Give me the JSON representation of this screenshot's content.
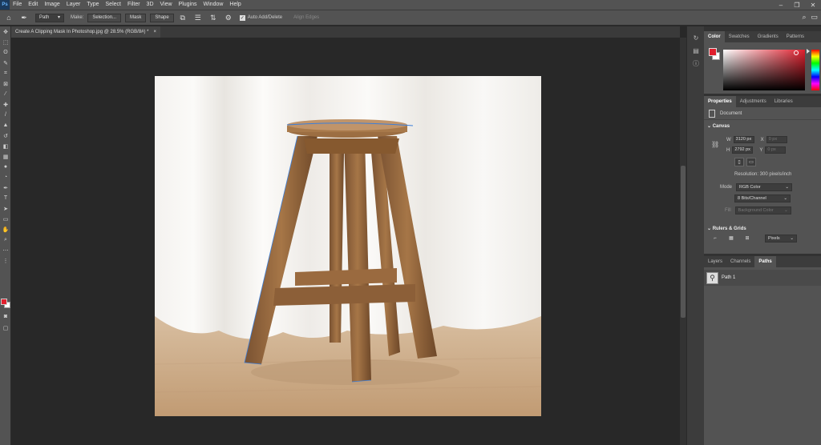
{
  "app": {
    "logo": "Ps"
  },
  "menu": [
    "File",
    "Edit",
    "Image",
    "Layer",
    "Type",
    "Select",
    "Filter",
    "3D",
    "View",
    "Plugins",
    "Window",
    "Help"
  ],
  "window_controls": {
    "minimize": "–",
    "restore": "❐",
    "close": "✕"
  },
  "options": {
    "mode": "Path",
    "make_label": "Make:",
    "selection_btn": "Selection...",
    "mask_btn": "Mask",
    "shape_btn": "Shape",
    "auto_add_delete": "Auto Add/Delete",
    "align_edges": "Align Edges"
  },
  "document": {
    "tab_title": "Create A Clipping Mask In Photoshop.jpg @ 28.5% (RGB/8#) *",
    "close": "×"
  },
  "color_panel": {
    "tabs": [
      "Color",
      "Swatches",
      "Gradients",
      "Patterns"
    ],
    "active_tab": 0,
    "foreground": "#e0202e",
    "background": "#ffffff"
  },
  "properties": {
    "tabs": [
      "Properties",
      "Adjustments",
      "Libraries"
    ],
    "doc_label": "Document",
    "canvas_heading": "Canvas",
    "w_label": "W",
    "w_value": "3120 px",
    "h_label": "H",
    "h_value": "2792 px",
    "x_label": "X",
    "x_value": "0 px",
    "y_label": "Y",
    "y_value": "0 px",
    "resolution": "Resolution: 300 pixels/inch",
    "mode_label": "Mode",
    "mode_value": "RGB Color",
    "depth_value": "8 Bits/Channel",
    "fill_label": "Fill",
    "fill_value": "Background Color",
    "rulers_heading": "Rulers & Grids",
    "units_value": "Pixels"
  },
  "paths_panel": {
    "tabs": [
      "Layers",
      "Channels",
      "Paths"
    ],
    "active_tab": 2,
    "items": [
      {
        "name": "Path 1"
      }
    ]
  },
  "colors": {
    "accent": "#e0202e",
    "path_line": "#3d7fd9"
  }
}
